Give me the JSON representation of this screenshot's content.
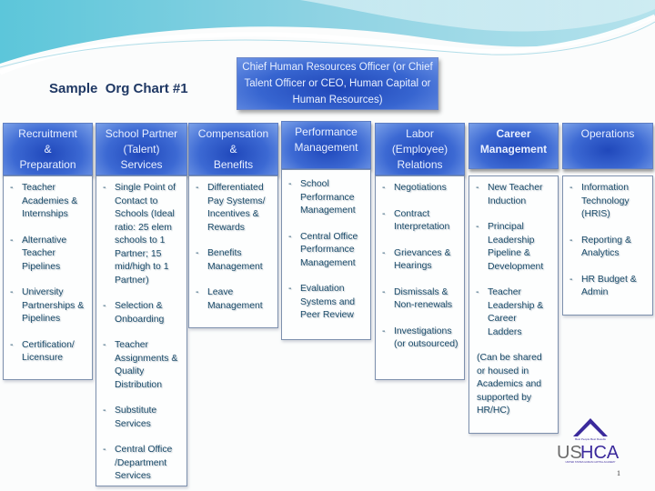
{
  "slide": {
    "title": "Sample  Org Chart #1",
    "page_number": "1"
  },
  "top_box": {
    "text": "Chief Human Resources Officer (or Chief Talent Officer or CEO, Human Capital or Human Resources)"
  },
  "columns": [
    {
      "header": [
        "Recruitment",
        "&",
        "Preparation"
      ],
      "bold": false,
      "items": [
        "Teacher Academies & Internships",
        "Alternative Teacher Pipelines",
        "University Partnerships & Pipelines",
        "Certification/ Licensure"
      ],
      "note": ""
    },
    {
      "header": [
        "School Partner",
        "(Talent)",
        "Services"
      ],
      "bold": false,
      "items": [
        "Single Point of Contact to Schools (Ideal ratio: 25 elem schools to 1 Partner; 15 mid/high to 1 Partner)",
        "Selection & Onboarding",
        "Teacher Assignments & Quality Distribution",
        "Substitute Services",
        "Central Office /Department Services"
      ],
      "note": ""
    },
    {
      "header": [
        "Compensation",
        "&",
        "Benefits"
      ],
      "bold": false,
      "items": [
        "Differentiated Pay Systems/ Incentives & Rewards",
        "Benefits Management",
        "Leave Management"
      ],
      "note": ""
    },
    {
      "header": [
        "Performance",
        "Management"
      ],
      "bold": false,
      "items": [
        "School Performance Management",
        "Central Office Performance Management",
        "Evaluation Systems and Peer Review"
      ],
      "note": ""
    },
    {
      "header": [
        "Labor",
        "(Employee)",
        "Relations"
      ],
      "bold": false,
      "items": [
        "Negotiations",
        "Contract Interpretation",
        "Grievances & Hearings",
        "Dismissals & Non-renewals",
        "Investigations (or outsourced)"
      ],
      "note": ""
    },
    {
      "header": [
        "Career",
        "Management"
      ],
      "bold": true,
      "items": [
        "New Teacher Induction",
        "Principal Leadership Pipeline & Development",
        "Teacher Leadership & Career Ladders"
      ],
      "note": "(Can be shared or housed in Academics and supported by HR/HC)"
    },
    {
      "header": [
        "Operations"
      ],
      "bold": false,
      "items": [
        "Information Technology (HRIS)",
        "Reporting & Analytics",
        "HR Budget & Admin"
      ],
      "note": ""
    }
  ],
  "logo": {
    "text_us": "US",
    "text_hca": "HCA",
    "tagline": "Best People Best Results",
    "subtitle": "UNITED STATES HUMAN CAPITAL ACADEMY"
  },
  "colors": {
    "header_blue": "#2f5bc8",
    "title_navy": "#1f3864",
    "item_text": "#1d4d6b",
    "logo_purple": "#3b2a9c",
    "logo_gray": "#6b6b6b"
  }
}
